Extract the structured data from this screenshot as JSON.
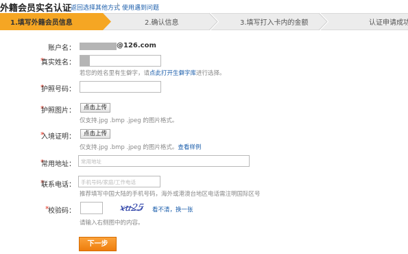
{
  "header": {
    "title": "外籍会员实名认证",
    "link_other": "返回选择其他方式",
    "separator": "|",
    "link_problem": "使用遇到问题"
  },
  "steps": [
    {
      "label": "1.填写外籍会员信息",
      "active": true
    },
    {
      "label": "2.确认信息",
      "active": false
    },
    {
      "label": "3.填写打入卡内的金额",
      "active": false
    },
    {
      "label": "认证申请成功",
      "active": false
    }
  ],
  "colors": {
    "accent": "#f5a623",
    "link": "#1a5dab",
    "required": "#e0301e",
    "button": "#ee7d0d"
  },
  "form": {
    "account": {
      "label": "账户名：",
      "value": "@126.com"
    },
    "real_name": {
      "label": "真实姓名：",
      "value": "",
      "hint_prefix": "若您的姓名里有生僻字，请",
      "hint_link": "点此打开生僻字库",
      "hint_suffix": "进行选择。"
    },
    "passport_no": {
      "label": "护照号码：",
      "value": ""
    },
    "passport_img": {
      "label": "护照图片：",
      "button": "点击上传",
      "hint": "仅支持.jpg .bmp .jpeg 的图片格式。"
    },
    "entry_proof": {
      "label": "入境证明：",
      "button": "点击上传",
      "hint": "仅支持.jpg .bmp .jpeg 的图片格式。",
      "hint_link": "查看样例"
    },
    "address": {
      "label": "常用地址：",
      "placeholder": "常用地址"
    },
    "phone": {
      "label": "联系电话：",
      "placeholder": "手机号码/家庭/工作电话",
      "hint": "推荐填写中国大陆的手机号码，海外或港澳台地区电话需注明国际区号"
    },
    "captcha": {
      "label": "校验码：",
      "value": "",
      "image_text": "xu25",
      "refresh": "看不清，换一张",
      "hint": "请输入右侧图中的内容。"
    }
  },
  "next_button": "下一步"
}
